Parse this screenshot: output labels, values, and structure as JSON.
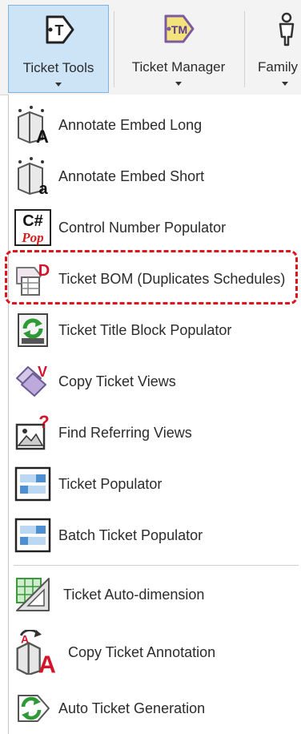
{
  "ribbon": {
    "buttons": [
      {
        "label": "Ticket Tools",
        "icon": "ticket-t-icon",
        "active": true
      },
      {
        "label": "Ticket Manager",
        "icon": "ticket-tm-icon",
        "active": false
      },
      {
        "label": "Family",
        "icon": "family-figure-icon",
        "active": false
      }
    ]
  },
  "menu": {
    "items": [
      {
        "label": "Annotate Embed Long",
        "icon": "annotate-embed-long-icon"
      },
      {
        "label": "Annotate Embed Short",
        "icon": "annotate-embed-short-icon"
      },
      {
        "label": "Control Number Populator",
        "icon": "csharp-pop-icon"
      },
      {
        "label": "Ticket BOM (Duplicates Schedules)",
        "icon": "ticket-bom-icon",
        "highlighted": true
      },
      {
        "label": "Ticket Title Block Populator",
        "icon": "refresh-title-block-icon"
      },
      {
        "label": "Copy Ticket Views",
        "icon": "copy-views-icon"
      },
      {
        "label": "Find Referring Views",
        "icon": "find-referring-views-icon"
      },
      {
        "label": "Ticket Populator",
        "icon": "ticket-populator-icon"
      },
      {
        "label": "Batch Ticket Populator",
        "icon": "batch-ticket-populator-icon"
      },
      {
        "label": "Ticket Auto-dimension",
        "icon": "auto-dimension-icon"
      },
      {
        "label": "Copy Ticket Annotation",
        "icon": "copy-annotation-icon"
      },
      {
        "label": "Auto Ticket Generation",
        "icon": "auto-generation-icon"
      }
    ]
  },
  "colors": {
    "active_tab_bg": "#cde4f7",
    "highlight_border": "#e0141b",
    "text": "#2b2b2b"
  }
}
